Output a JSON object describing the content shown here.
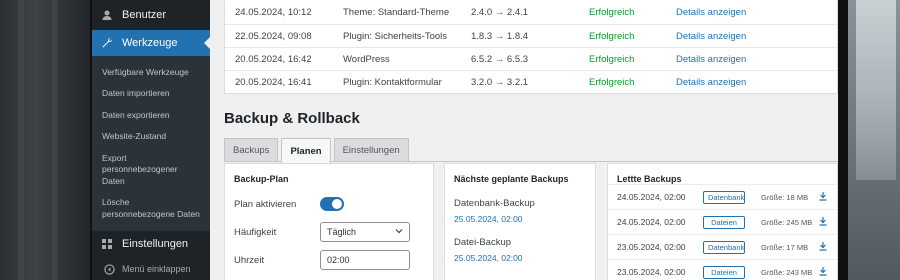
{
  "sidebar": {
    "users_label": "Benutzer",
    "tools_label": "Werkzeuge",
    "submenu": [
      "Verfügbare Werkzeuge",
      "Daten importieren",
      "Daten exportieren",
      "Website-Zustand",
      "Export personnebezogener Daten",
      "Lösche personnebezogene Daten"
    ],
    "settings_label": "Einstellungen",
    "collapse_label": "Menü einklappen"
  },
  "update_log": [
    {
      "date": "24.05.2024, 10:12",
      "item": "Theme: Standard-Theme",
      "from": "2.4.0",
      "to": "2.4.1",
      "status": "Erfolgreich",
      "link": "Details anzeigen"
    },
    {
      "date": "22.05.2024, 09:08",
      "item": "Plugin: Sicherheits-Tools",
      "from": "1.8.3",
      "to": "1.8.4",
      "status": "Erfolgreich",
      "link": "Details anzeigen"
    },
    {
      "date": "20.05.2024, 16:42",
      "item": "WordPress",
      "from": "6.5.2",
      "to": "6.5.3",
      "status": "Erfolgreich",
      "link": "Details anzeigen"
    },
    {
      "date": "20.05.2024, 16:41",
      "item": "Plugin: Kontaktformular",
      "from": "3.2.0",
      "to": "3.2.1",
      "status": "Erfolgreich",
      "link": "Details anzeigen"
    }
  ],
  "arrow": "→",
  "section_title": "Backup & Rollback",
  "tabs": [
    "Backups",
    "Planen",
    "Einstellungen"
  ],
  "plan": {
    "title": "Backup-Plan",
    "activate_label": "Plan aktivieren",
    "activate_on": true,
    "frequency_label": "Häufigkeit",
    "frequency_value": "Täglich",
    "time_label": "Uhrzeit",
    "time_value": "02:00"
  },
  "next": {
    "title": "Nächste geplante Backups",
    "items": [
      {
        "name": "Datenbank-Backup",
        "date": "25.05.2024, 02:00"
      },
      {
        "name": "Datei-Backup",
        "date": "25.05.2024, 02:00"
      }
    ]
  },
  "recent": {
    "title": "Lettte Backups",
    "rows": [
      {
        "date": "24.05.2024, 02:00",
        "type": "Datenbank",
        "size": "Größe: 18 MB"
      },
      {
        "date": "24.05.2024, 02:00",
        "type": "Dateien",
        "size": "Größe: 245 MB"
      },
      {
        "date": "23.05.2024, 02:00",
        "type": "Datenbank",
        "size": "Größe: 17 MB"
      },
      {
        "date": "23.05.2024, 02:00",
        "type": "Dateien",
        "size": "Größe: 243 MB"
      }
    ]
  },
  "colors": {
    "accent": "#2271b1",
    "success": "#00a32a",
    "sidebar": "#1d2327"
  }
}
